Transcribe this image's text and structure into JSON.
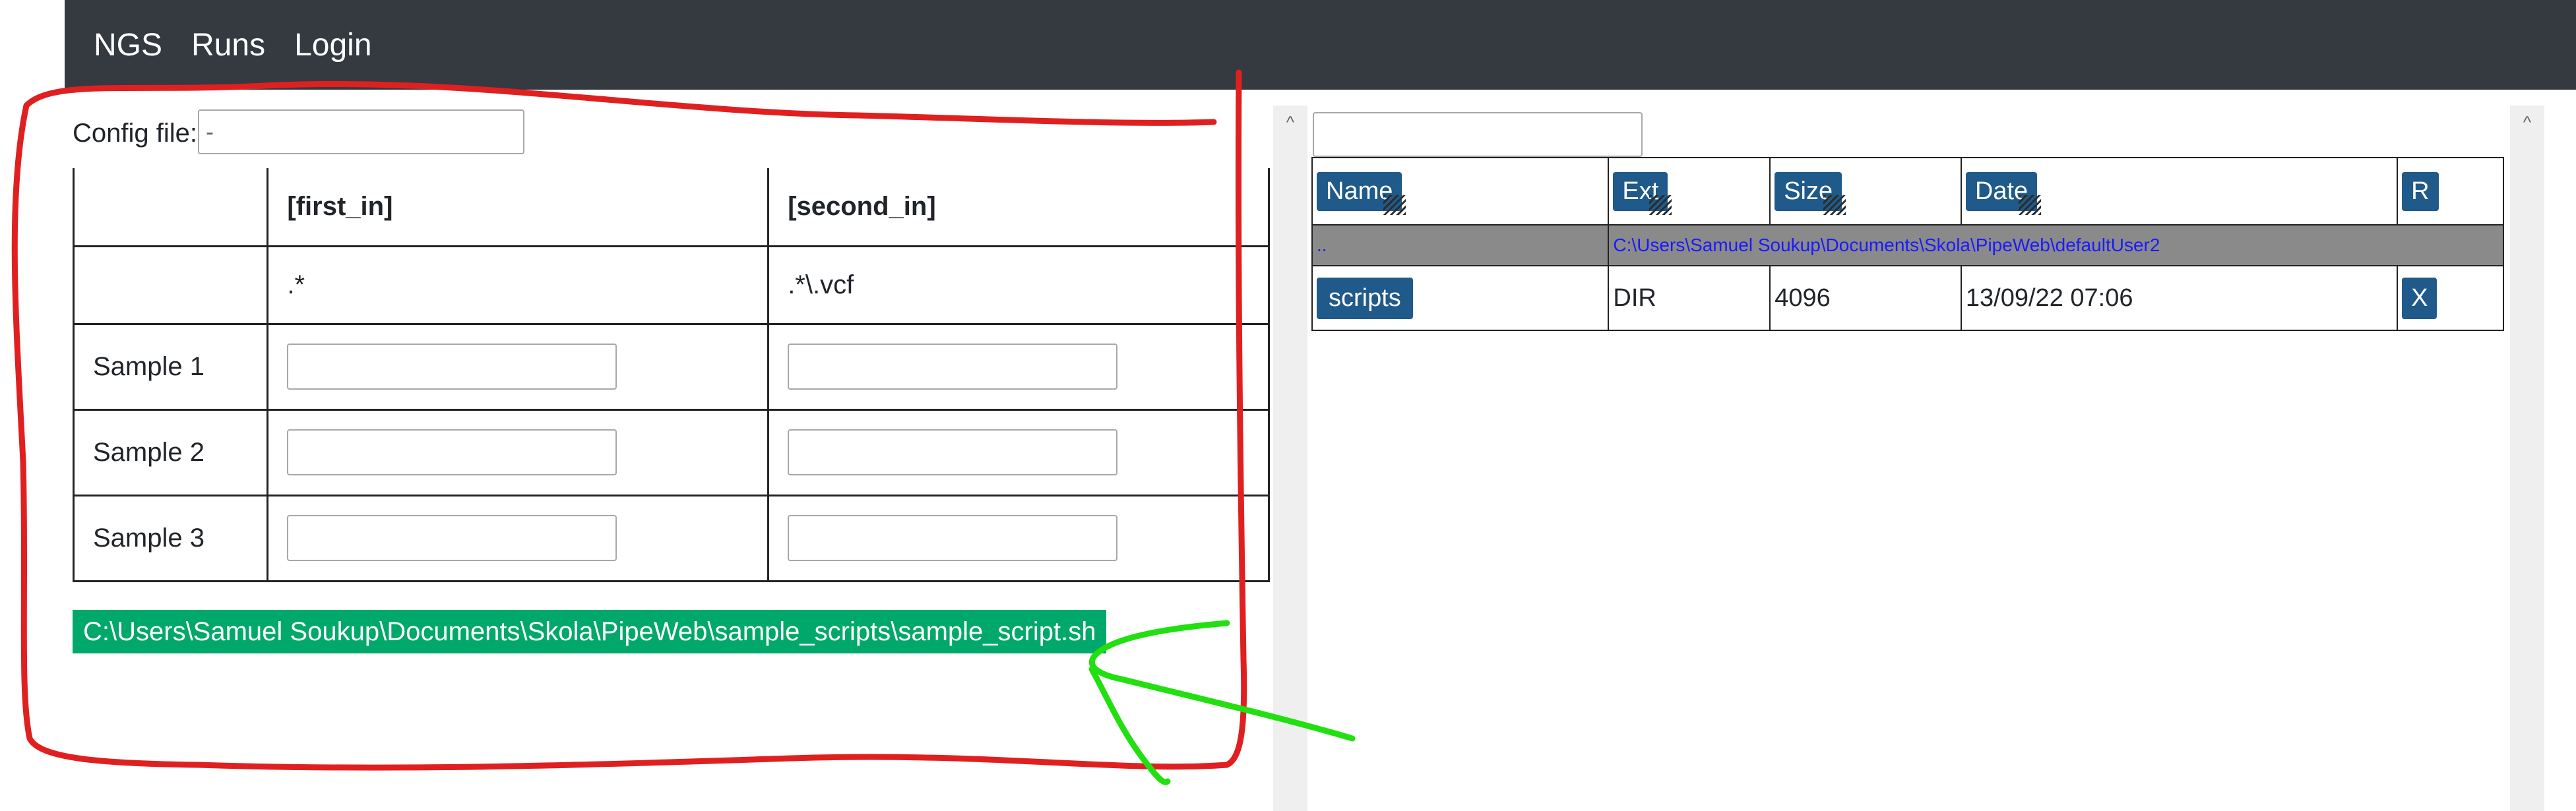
{
  "navbar": {
    "brand": "NGS",
    "links": [
      "Runs",
      "Login"
    ]
  },
  "config": {
    "label": "Config file:",
    "value": "-"
  },
  "samples_table": {
    "headers": [
      "",
      "[first_in]",
      "[second_in]"
    ],
    "patterns": [
      "",
      ".*",
      ".*\\.vcf"
    ],
    "rows": [
      "Sample 1",
      "Sample 2",
      "Sample 3"
    ]
  },
  "script_path": "C:\\Users\\Samuel Soukup\\Documents\\Skola\\PipeWeb\\sample_scripts\\sample_script.sh",
  "file_browser": {
    "columns": [
      "Name",
      "Ext",
      "Size",
      "Date",
      "R"
    ],
    "parent": {
      "name": "..",
      "path": "C:\\Users\\Samuel Soukup\\Documents\\Skola\\PipeWeb\\defaultUser2"
    },
    "rows": [
      {
        "name": "scripts",
        "ext": "DIR",
        "size": "4096",
        "date": "13/09/22 07:06",
        "action": "X"
      }
    ]
  },
  "scroll_arrow": "^",
  "annotation_colors": {
    "box": "#e02020",
    "arrow": "#22e010",
    "button": "#00a86b",
    "navbar": "#343a40"
  }
}
